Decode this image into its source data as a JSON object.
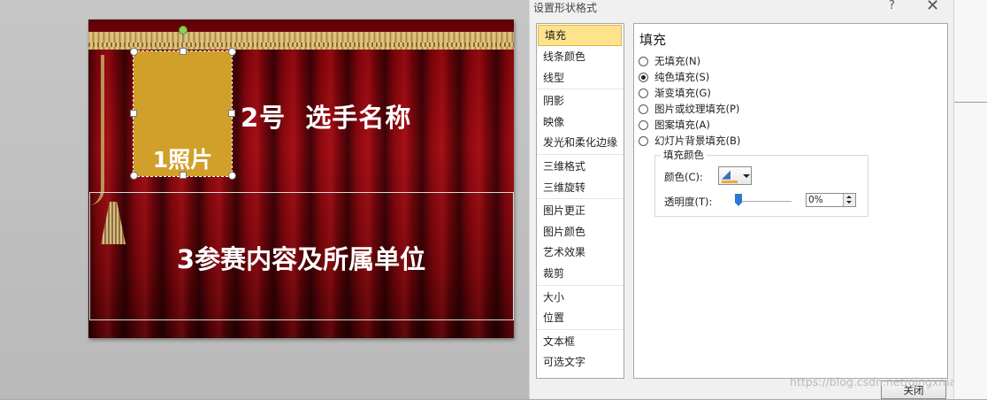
{
  "dialog": {
    "title": "设置形状格式",
    "help_label": "?",
    "close_icon_label": "✕",
    "close_button_label": "关闭"
  },
  "nav": {
    "items": [
      {
        "label": "填充",
        "selected": true
      },
      {
        "label": "线条颜色"
      },
      {
        "label": "线型"
      },
      {
        "label": "阴影"
      },
      {
        "label": "映像"
      },
      {
        "label": "发光和柔化边缘"
      },
      {
        "label": "三维格式"
      },
      {
        "label": "三维旋转"
      },
      {
        "label": "图片更正"
      },
      {
        "label": "图片颜色"
      },
      {
        "label": "艺术效果"
      },
      {
        "label": "裁剪"
      },
      {
        "label": "大小"
      },
      {
        "label": "位置"
      },
      {
        "label": "文本框"
      },
      {
        "label": "可选文字"
      }
    ]
  },
  "fill_panel": {
    "title": "填充",
    "options": [
      {
        "label": "无填充(N)",
        "checked": false
      },
      {
        "label": "纯色填充(S)",
        "checked": true
      },
      {
        "label": "渐变填充(G)",
        "checked": false
      },
      {
        "label": "图片或纹理填充(P)",
        "checked": false
      },
      {
        "label": "图案填充(A)",
        "checked": false
      },
      {
        "label": "幻灯片背景填充(B)",
        "checked": false
      }
    ],
    "group_title": "填充颜色",
    "color_label": "颜色(C):",
    "color_value": "#f0a93b",
    "transparency_label": "透明度(T):",
    "transparency_value": "0%",
    "transparency_fraction": 0
  },
  "slide": {
    "photo_label": "1照片",
    "photo_fill": "#d1a02b",
    "name_text": "2号  选手名称",
    "content_text": "3参赛内容及所属单位"
  },
  "watermark": "https://blog.csdn.net/qingxmar"
}
